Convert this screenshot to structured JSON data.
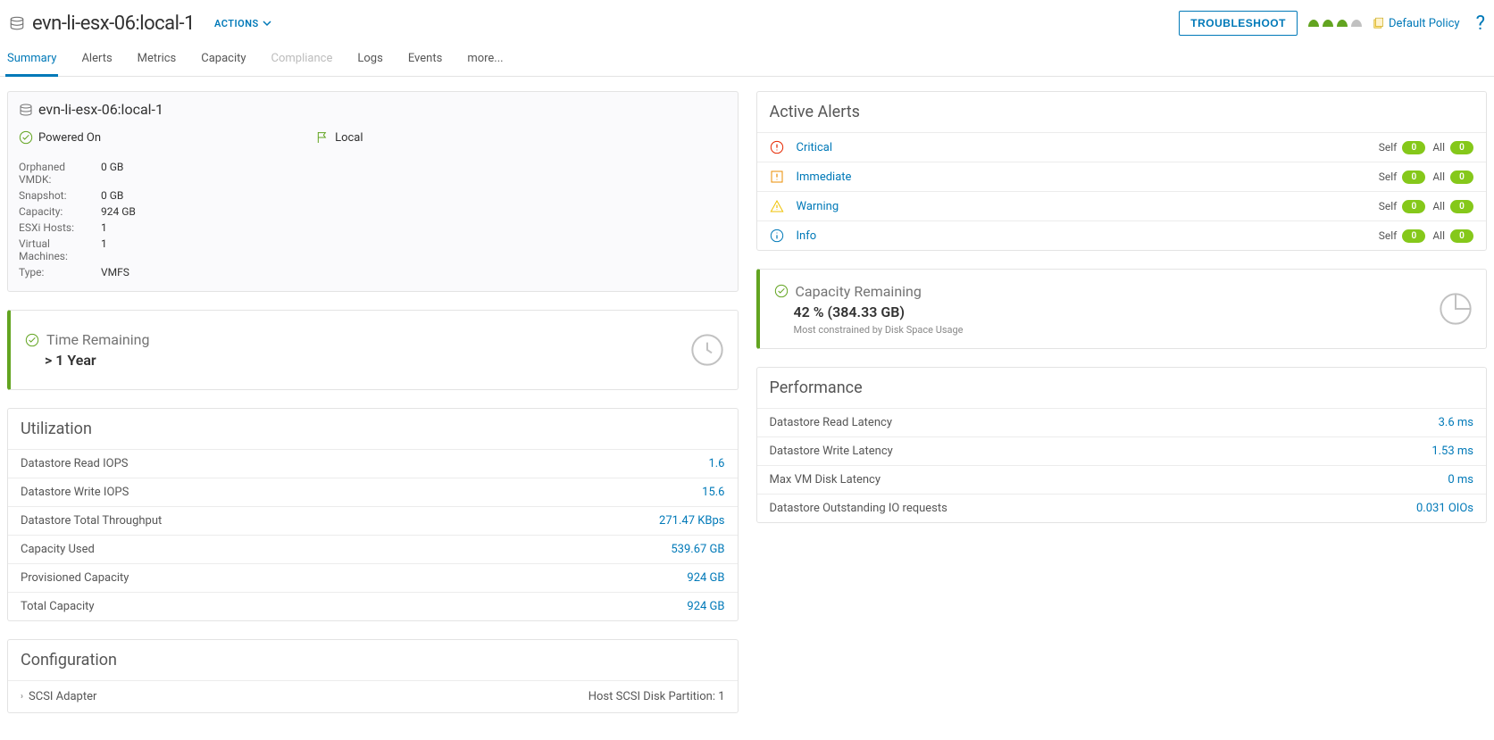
{
  "header": {
    "title": "evn-li-esx-06:local-1",
    "actions_label": "ACTIONS",
    "troubleshoot_label": "TROUBLESHOOT",
    "policy_label": "Default Policy"
  },
  "tabs": [
    {
      "label": "Summary",
      "state": "active"
    },
    {
      "label": "Alerts",
      "state": ""
    },
    {
      "label": "Metrics",
      "state": ""
    },
    {
      "label": "Capacity",
      "state": ""
    },
    {
      "label": "Compliance",
      "state": "disabled"
    },
    {
      "label": "Logs",
      "state": ""
    },
    {
      "label": "Events",
      "state": ""
    },
    {
      "label": "more...",
      "state": ""
    }
  ],
  "summary": {
    "title": "evn-li-esx-06:local-1",
    "status_powered": "Powered On",
    "status_local": "Local",
    "props": [
      {
        "k": "Orphaned VMDK:",
        "v": "0 GB"
      },
      {
        "k": "Snapshot:",
        "v": "0 GB"
      },
      {
        "k": "Capacity:",
        "v": "924 GB"
      },
      {
        "k": "ESXi Hosts:",
        "v": "1"
      },
      {
        "k": "Virtual Machines:",
        "v": "1"
      },
      {
        "k": "Type:",
        "v": "VMFS"
      }
    ]
  },
  "alerts": {
    "title": "Active Alerts",
    "rows": [
      {
        "label": "Critical",
        "self": "0",
        "all": "0"
      },
      {
        "label": "Immediate",
        "self": "0",
        "all": "0"
      },
      {
        "label": "Warning",
        "self": "0",
        "all": "0"
      },
      {
        "label": "Info",
        "self": "0",
        "all": "0"
      }
    ],
    "self_label": "Self",
    "all_label": "All"
  },
  "time_remaining": {
    "title": "Time Remaining",
    "value": "> 1 Year"
  },
  "capacity_remaining": {
    "title": "Capacity Remaining",
    "value": "42 % (384.33 GB)",
    "sub": "Most constrained by Disk Space Usage"
  },
  "utilization": {
    "title": "Utilization",
    "rows": [
      {
        "k": "Datastore Read IOPS",
        "v": "1.6"
      },
      {
        "k": "Datastore Write IOPS",
        "v": "15.6"
      },
      {
        "k": "Datastore Total Throughput",
        "v": "271.47 KBps"
      },
      {
        "k": "Capacity Used",
        "v": "539.67 GB"
      },
      {
        "k": "Provisioned Capacity",
        "v": "924 GB"
      },
      {
        "k": "Total Capacity",
        "v": "924 GB"
      }
    ]
  },
  "performance": {
    "title": "Performance",
    "rows": [
      {
        "k": "Datastore Read Latency",
        "v": "3.6 ms"
      },
      {
        "k": "Datastore Write Latency",
        "v": "1.53 ms"
      },
      {
        "k": "Max VM Disk Latency",
        "v": "0 ms"
      },
      {
        "k": "Datastore Outstanding IO requests",
        "v": "0.031 OIOs"
      }
    ]
  },
  "configuration": {
    "title": "Configuration",
    "row_label": "SCSI Adapter",
    "row_value": "Host SCSI Disk Partition: 1"
  }
}
